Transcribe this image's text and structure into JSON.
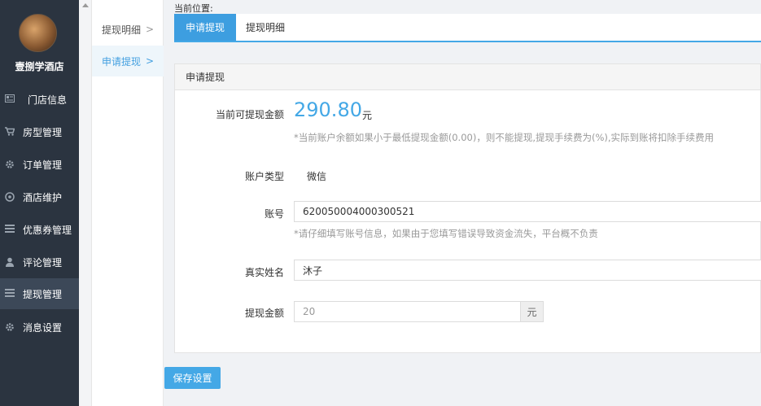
{
  "sidebar": {
    "hotel_name": "壹捌学酒店",
    "items": [
      {
        "label": "门店信息",
        "icon": "newspaper-icon"
      },
      {
        "label": "房型管理",
        "icon": "cart-icon"
      },
      {
        "label": "订单管理",
        "icon": "gear-icon"
      },
      {
        "label": "酒店维护",
        "icon": "compass-icon"
      },
      {
        "label": "优惠券管理",
        "icon": "list-icon"
      },
      {
        "label": "评论管理",
        "icon": "user-icon"
      },
      {
        "label": "提现管理",
        "icon": "list-icon",
        "active": true
      },
      {
        "label": "消息设置",
        "icon": "gear-icon"
      }
    ]
  },
  "submenu": {
    "items": [
      {
        "label": "提现明细"
      },
      {
        "label": "申请提现",
        "active": true
      }
    ],
    "arrow": ">"
  },
  "breadcrumb": {
    "label": "当前位置:"
  },
  "tabs": [
    {
      "label": "申请提现",
      "active": true
    },
    {
      "label": "提现明细"
    }
  ],
  "panel": {
    "title": "申请提现",
    "available": {
      "label": "当前可提现金额",
      "amount": "290.80",
      "unit": "元",
      "hint": "*当前账户余额如果小于最低提现金额(0.00)，则不能提现,提现手续费为(%),实际到账将扣除手续费用"
    },
    "account_type": {
      "label": "账户类型",
      "value": "微信"
    },
    "account_no": {
      "label": "账号",
      "value": "620050004000300521",
      "hint": "*请仔细填写账号信息，如果由于您填写错误导致资金流失，平台概不负责"
    },
    "real_name": {
      "label": "真实姓名",
      "value": "沐子"
    },
    "withdraw_amount": {
      "label": "提现金额",
      "placeholder": "20",
      "unit": "元"
    }
  },
  "save_button": {
    "label": "保存设置"
  },
  "colors": {
    "accent": "#44a8e6",
    "sidebar_bg": "#2b3440"
  }
}
